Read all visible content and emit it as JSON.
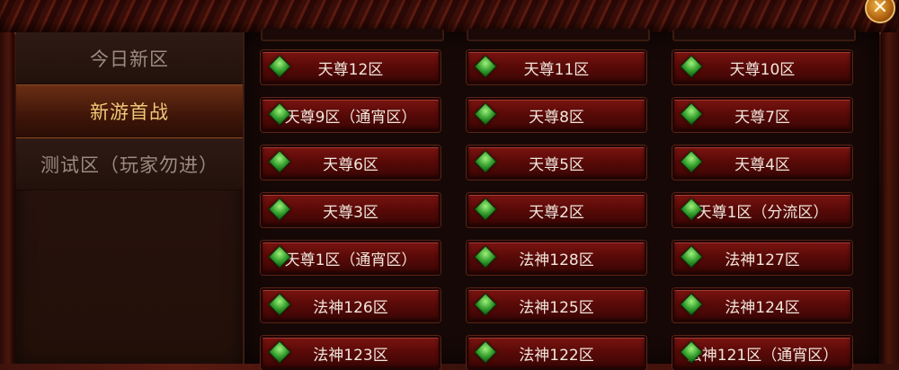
{
  "sidebar": {
    "tabs": [
      {
        "label": "今日新区",
        "active": false
      },
      {
        "label": "新游首战",
        "active": true
      },
      {
        "label": "测试区（玩家勿进）",
        "active": false
      }
    ]
  },
  "close_label": "✕",
  "colors": {
    "status_dot": "#3fae33",
    "active_tab_text": "#f2c878",
    "button_red": "#6a0e0a"
  },
  "servers": [
    {
      "label": "天尊12区"
    },
    {
      "label": "天尊11区"
    },
    {
      "label": "天尊10区"
    },
    {
      "label": "天尊9区（通宵区）"
    },
    {
      "label": "天尊8区"
    },
    {
      "label": "天尊7区"
    },
    {
      "label": "天尊6区"
    },
    {
      "label": "天尊5区"
    },
    {
      "label": "天尊4区"
    },
    {
      "label": "天尊3区"
    },
    {
      "label": "天尊2区"
    },
    {
      "label": "天尊1区（分流区）"
    },
    {
      "label": "天尊1区（通宵区）"
    },
    {
      "label": "法神128区"
    },
    {
      "label": "法神127区"
    },
    {
      "label": "法神126区"
    },
    {
      "label": "法神125区"
    },
    {
      "label": "法神124区"
    },
    {
      "label": "法神123区"
    },
    {
      "label": "法神122区"
    },
    {
      "label": "法神121区（通宵区）"
    }
  ]
}
